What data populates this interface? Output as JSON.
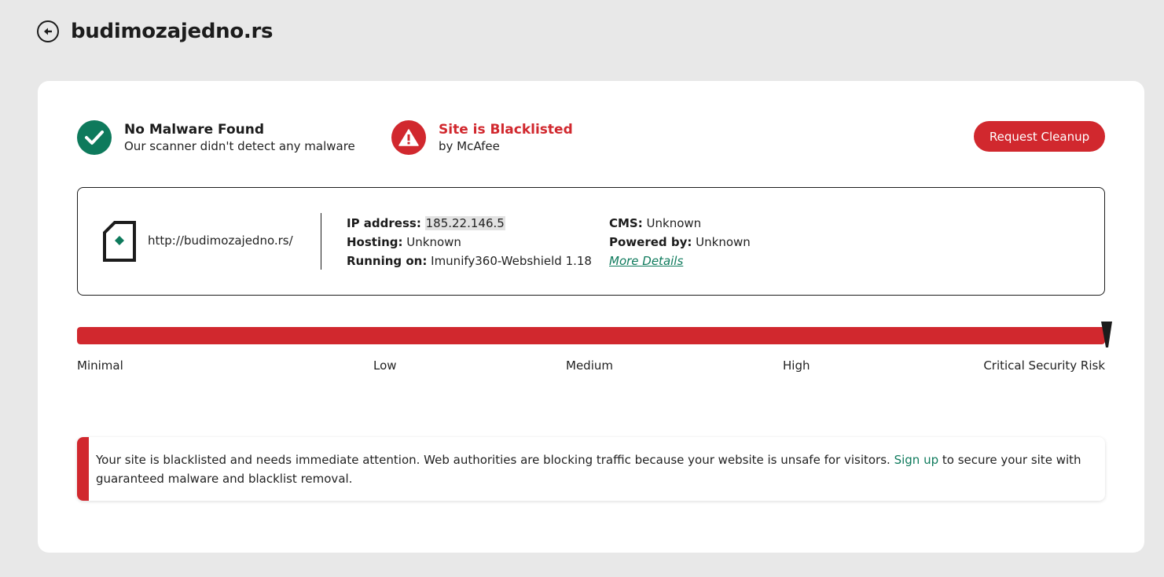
{
  "header": {
    "title": "budimozajedno.rs",
    "back_icon": "arrow-left-circle-icon"
  },
  "status": {
    "malware": {
      "icon": "check-circle-icon",
      "color": "#0e7a5c",
      "title": "No Malware Found",
      "subtitle": "Our scanner didn't detect any malware"
    },
    "blacklist": {
      "icon": "warning-circle-icon",
      "color": "#d1282e",
      "title": "Site is Blacklisted",
      "subtitle": "by McAfee"
    },
    "cleanup_button": "Request Cleanup"
  },
  "site_info": {
    "icon": "site-file-icon",
    "url": "http://budimozajedno.rs/",
    "ip_label": "IP address:",
    "ip_value": "185.22.146.5",
    "hosting_label": "Hosting:",
    "hosting_value": "Unknown",
    "running_label": "Running on:",
    "running_value": "Imunify360-Webshield 1.18",
    "cms_label": "CMS:",
    "cms_value": "Unknown",
    "powered_label": "Powered by:",
    "powered_value": "Unknown",
    "more_details": "More Details"
  },
  "risk": {
    "level_fraction": 1.0,
    "fill_color": "#d1282e",
    "labels": [
      "Minimal",
      "Low",
      "Medium",
      "High",
      "Critical Security Risk"
    ]
  },
  "alert": {
    "text_before": "Your site is blacklisted and needs immediate attention. Web authorities are blocking traffic because your website is unsafe for visitors.",
    "link": "Sign up",
    "text_after": "to secure your site with guaranteed malware and blacklist removal."
  }
}
